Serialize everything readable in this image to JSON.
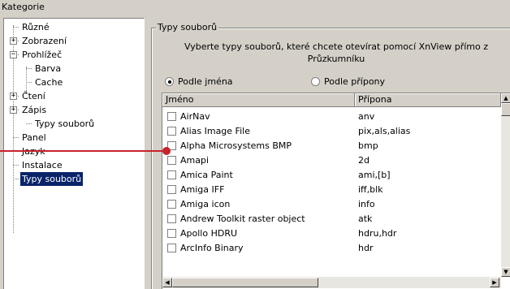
{
  "category_label": "Kategorie",
  "tree": [
    {
      "label": "Různé",
      "level": 0,
      "expander": ""
    },
    {
      "label": "Zobrazení",
      "level": 0,
      "expander": "+"
    },
    {
      "label": "Prohlížeč",
      "level": 0,
      "expander": "−"
    },
    {
      "label": "Barva",
      "level": 1,
      "expander": ""
    },
    {
      "label": "Cache",
      "level": 1,
      "expander": ""
    },
    {
      "label": "Čtení",
      "level": 0,
      "expander": "+"
    },
    {
      "label": "Zápis",
      "level": 0,
      "expander": "+"
    },
    {
      "label": "Typy souborů",
      "level": 1,
      "expander": ""
    },
    {
      "label": "Panel",
      "level": 0,
      "expander": ""
    },
    {
      "label": "Jazyk",
      "level": 0,
      "expander": ""
    },
    {
      "label": "Instalace",
      "level": 0,
      "expander": ""
    },
    {
      "label": "Typy souborů",
      "level": 0,
      "expander": "",
      "selected": true
    }
  ],
  "group_title": "Typy souborů",
  "description": "Vyberte typy souborů, které chcete otevírat pomocí XnView přímo z Průzkumníku",
  "radio_by_name": "Podle jména",
  "radio_by_ext": "Podle přípony",
  "columns": {
    "name": "Jméno",
    "ext": "Přípona"
  },
  "rows": [
    {
      "name": "AirNav",
      "ext": "anv"
    },
    {
      "name": "Alias Image File",
      "ext": "pix,als,alias"
    },
    {
      "name": "Alpha Microsystems BMP",
      "ext": "bmp"
    },
    {
      "name": "Amapi",
      "ext": "2d"
    },
    {
      "name": "Amica Paint",
      "ext": "ami,[b]"
    },
    {
      "name": "Amiga IFF",
      "ext": "iff,blk"
    },
    {
      "name": "Amiga icon",
      "ext": "info"
    },
    {
      "name": "Andrew Toolkit raster object",
      "ext": "atk"
    },
    {
      "name": "Apollo HDRU",
      "ext": "hdru,hdr"
    },
    {
      "name": "ArcInfo Binary",
      "ext": "hdr"
    }
  ],
  "colors": {
    "selection": "#0a246a",
    "pointer": "#c8232c",
    "background": "#d7eadb"
  }
}
